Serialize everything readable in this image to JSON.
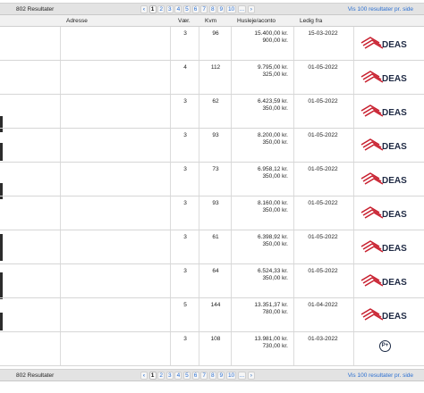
{
  "pagination": {
    "result_count": "802 Resultater",
    "prev_icon": "‹",
    "pages": [
      "1",
      "2",
      "3",
      "4",
      "5",
      "6",
      "7",
      "8",
      "9",
      "10",
      "..."
    ],
    "current_page": "1",
    "next_icon": "›",
    "per_page_link": "Vis 100 resultater pr. side"
  },
  "table": {
    "headers": {
      "address": "Adresse",
      "rooms": "Vær.",
      "sqm": "Kvm",
      "rent": "Husleje/aconto",
      "available": "Ledig fra"
    },
    "rows": [
      {
        "rooms": "3",
        "sqm": "96",
        "rent": "15.400,00 kr.",
        "aconto": "900,00 kr.",
        "available": "15-03-2022",
        "logo": "DEAS"
      },
      {
        "rooms": "4",
        "sqm": "112",
        "rent": "9.795,00 kr.",
        "aconto": "325,00 kr.",
        "available": "01-05-2022",
        "logo": "DEAS"
      },
      {
        "rooms": "3",
        "sqm": "62",
        "rent": "6.423,59 kr.",
        "aconto": "350,00 kr.",
        "available": "01-05-2022",
        "logo": "DEAS"
      },
      {
        "rooms": "3",
        "sqm": "93",
        "rent": "8.200,00 kr.",
        "aconto": "350,00 kr.",
        "available": "01-05-2022",
        "logo": "DEAS"
      },
      {
        "rooms": "3",
        "sqm": "73",
        "rent": "6.958,12 kr.",
        "aconto": "350,00 kr.",
        "available": "01-05-2022",
        "logo": "DEAS"
      },
      {
        "rooms": "3",
        "sqm": "93",
        "rent": "8.160,00 kr.",
        "aconto": "350,00 kr.",
        "available": "01-05-2022",
        "logo": "DEAS"
      },
      {
        "rooms": "3",
        "sqm": "61",
        "rent": "6.398,92 kr.",
        "aconto": "350,00 kr.",
        "available": "01-05-2022",
        "logo": "DEAS"
      },
      {
        "rooms": "3",
        "sqm": "64",
        "rent": "6.524,33 kr.",
        "aconto": "350,00 kr.",
        "available": "01-05-2022",
        "logo": "DEAS"
      },
      {
        "rooms": "5",
        "sqm": "144",
        "rent": "13.351,37 kr.",
        "aconto": "780,00 kr.",
        "available": "01-04-2022",
        "logo": "DEAS"
      },
      {
        "rooms": "3",
        "sqm": "108",
        "rent": "13.981,00 kr.",
        "aconto": "730,00 kr.",
        "available": "01-03-2022",
        "logo": "P+"
      }
    ]
  },
  "colors": {
    "brand_red": "#c8202f",
    "brand_text": "#1f2a44",
    "link": "#2b6fd1"
  }
}
